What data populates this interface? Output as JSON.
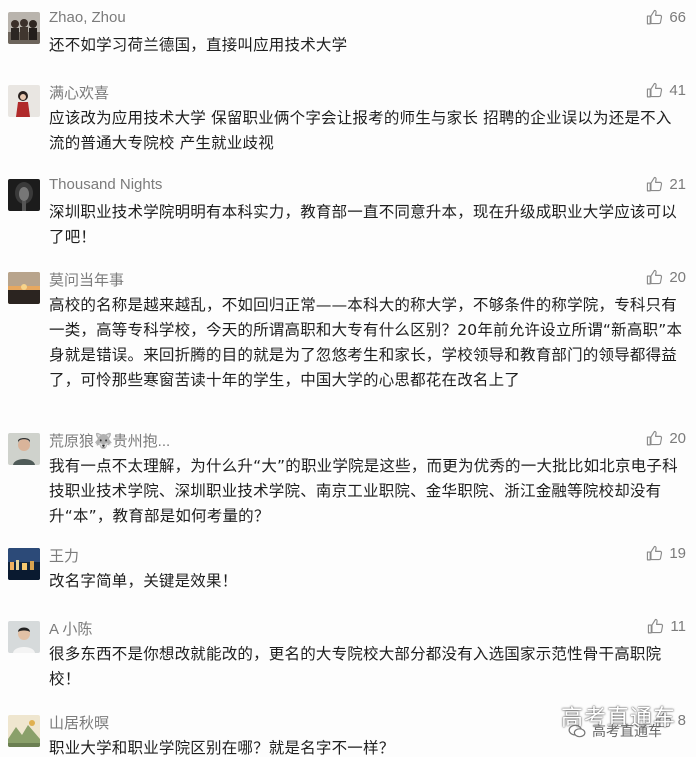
{
  "comments": [
    {
      "nick": "Zhao, Zhou",
      "likes": "66",
      "text": "还不如学习荷兰德国，直接叫应用技术大学",
      "avatar": "group-photo-avatar"
    },
    {
      "nick": "满心欢喜",
      "likes": "41",
      "text": "应该改为应用技术大学 保留职业俩个字会让报考的师生与家长 招聘的企业误以为还是不入流的普通大专院校 产生就业歧视",
      "avatar": "girl-photo-avatar"
    },
    {
      "nick": "Thousand Nights",
      "likes": "21",
      "text": "深圳职业技术学院明明有本科实力，教育部一直不同意升本，现在升级成职业大学应该可以了吧！",
      "avatar": "dark-photo-avatar"
    },
    {
      "nick": "莫问当年事",
      "likes": "20",
      "text": "高校的名称是越来越乱，不如回归正常——本科大的称大学，不够条件的称学院，专科只有一类，高等专科学校，今天的所谓高职和大专有什么区别？20年前允许设立所谓“新高职”本身就是错误。来回折腾的目的就是为了忽悠考生和家长，学校领导和教育部门的领导都得益了，可怜那些寒窗苦读十年的学生，中国大学的心思都花在改名上了",
      "avatar": "sunset-photo-avatar"
    },
    {
      "nick": "荒原狼🐺贵州抱...",
      "likes": "20",
      "text": "我有一点不太理解，为什么升“大”的职业学院是这些，而更为优秀的一大批比如北京电子科技职业技术学院、深圳职业技术学院、南京工业职院、金华职院、浙江金融等院校却没有升“本”，教育部是如何考量的？",
      "avatar": "man-photo-avatar"
    },
    {
      "nick": "王力",
      "likes": "19",
      "text": "改名字简单，关键是效果！",
      "avatar": "night-city-avatar"
    },
    {
      "nick": "A 小陈",
      "likes": "11",
      "text": "很多东西不是你想改就能改的，更名的大专院校大部分都没有入选国家示范性骨干高职院校！",
      "avatar": "boy-photo-avatar"
    },
    {
      "nick": "山居秋暝",
      "likes": "8",
      "text": "职业大学和职业学院区别在哪？就是名字不一样？",
      "avatar": "landscape-painting-avatar"
    }
  ],
  "watermark": {
    "title": "高考直通车",
    "subtitle": "高考直通车"
  },
  "colors": {
    "nick": "#7b7b7b",
    "text": "#1e1e1e",
    "like_icon": "#8a8a8a"
  }
}
